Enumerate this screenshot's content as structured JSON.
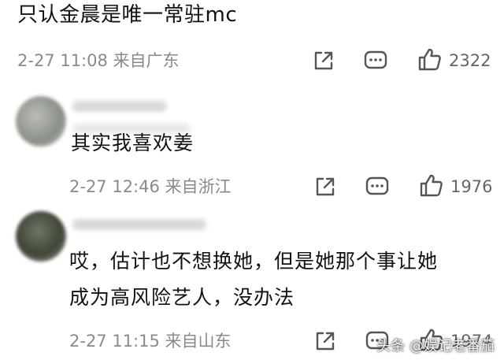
{
  "comments": [
    {
      "text": "只认金晨是唯一常驻mc",
      "meta": "2-27 11:08 来自广东",
      "likes": "2322"
    },
    {
      "text": "其实我喜欢姜",
      "meta": "2-27 12:46 来自浙江",
      "likes": "1976"
    },
    {
      "text_line1": "哎，估计也不想换她，但是她那个事让她",
      "text_line2": "成为高风险艺人，没办法",
      "meta": "2-27 11:15 来自山东",
      "likes": "1974"
    }
  ],
  "watermark": "头条 @娱记老番茄",
  "icons": [
    "share-icon",
    "comment-icon",
    "like-icon"
  ]
}
